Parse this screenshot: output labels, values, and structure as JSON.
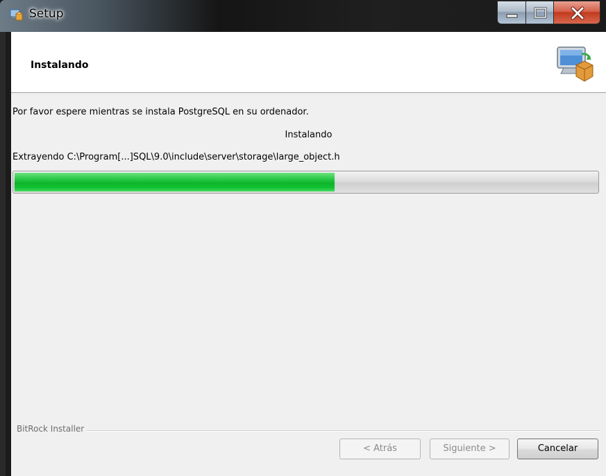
{
  "window": {
    "title": "Setup",
    "controls": {
      "minimize_icon": "minimize-icon",
      "maximize_icon": "maximize-icon",
      "close_icon": "close-icon"
    }
  },
  "header": {
    "title": "Instalando",
    "icon": "computer-package-icon"
  },
  "content": {
    "message": "Por favor espere mientras se instala PostgreSQL en su ordenador.",
    "status": "Instalando",
    "current_file": "Extrayendo C:\\Program[...]SQL\\9.0\\include\\server\\storage\\large_object.h",
    "progress_fraction": 0.55
  },
  "footer": {
    "brand": "BitRock Installer",
    "back_label": "< Atrás",
    "next_label": "Siguiente >",
    "cancel_label": "Cancelar"
  },
  "colors": {
    "progress_green": "#10c232",
    "close_red": "#c23a1f",
    "dialog_bg": "#f0f0f0"
  }
}
